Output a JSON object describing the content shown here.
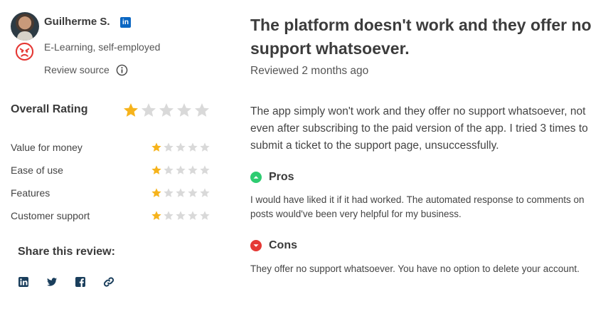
{
  "reviewer": {
    "name": "Guilherme S.",
    "linkedin_badge": "in",
    "industry": "E-Learning, self-employed",
    "source_label": "Review source",
    "sentiment_icon": "angry-face-icon"
  },
  "ratings": {
    "overall_label": "Overall Rating",
    "overall_value": 1,
    "max": 5,
    "items": [
      {
        "label": "Value for money",
        "value": 1
      },
      {
        "label": "Ease of use",
        "value": 1
      },
      {
        "label": "Features",
        "value": 1
      },
      {
        "label": "Customer support",
        "value": 1
      }
    ]
  },
  "share": {
    "label": "Share this review:",
    "icons": [
      "linkedin-icon",
      "twitter-icon",
      "facebook-icon",
      "link-icon"
    ]
  },
  "review": {
    "title": "The platform doesn't work and they offer no support whatsoever.",
    "reviewed": "Reviewed 2 months ago",
    "body": "The app simply won't work and they offer no support whatsoever, not even after subscribing to the paid version of the app. I tried 3 times to submit a ticket to the support page, unsuccessfully.",
    "pros_title": "Pros",
    "pros_text": "I would have liked it if it had worked. The automated response to comments on posts would've been very helpful for my business.",
    "cons_title": "Cons",
    "cons_text": "They offer no support whatsoever. You have no option to delete your account."
  },
  "colors": {
    "star_filled": "#f6b31b",
    "star_empty": "#d9d9d9",
    "pros": "#2ecc71",
    "cons": "#e53935",
    "linkedin": "#0a66c2",
    "share_icon": "#1a3e5c"
  }
}
